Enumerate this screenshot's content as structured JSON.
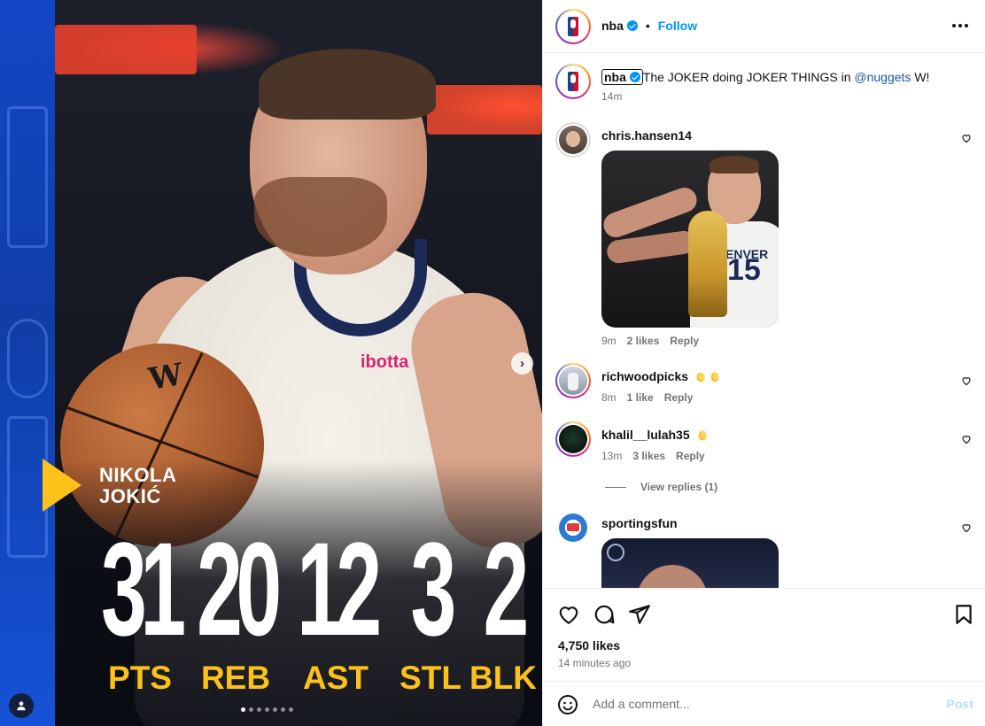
{
  "post": {
    "player": {
      "name_line1": "NIKOLA",
      "name_line2": "JOKIĆ"
    },
    "stats": [
      {
        "value": "31",
        "label": "PTS"
      },
      {
        "value": "20",
        "label": "REB"
      },
      {
        "value": "12",
        "label": "AST"
      },
      {
        "value": "3",
        "label": "STL"
      },
      {
        "value": "2",
        "label": "BLK"
      }
    ],
    "jersey_brand": "ibotta",
    "ball_brand": "W",
    "carousel": {
      "total": 7,
      "active": 0
    },
    "colors": {
      "accent_yellow": "#fcc21a",
      "side_blue": "#1346c6"
    }
  },
  "header": {
    "username": "nba",
    "follow_label": "Follow",
    "separator": "•"
  },
  "caption": {
    "username": "nba",
    "text_before": "The JOKER doing JOKER THINGS in ",
    "mention": "@nuggets",
    "text_after": " W!",
    "time": "14m"
  },
  "comments": [
    {
      "username": "chris.hansen14",
      "time": "9m",
      "likes": "2 likes",
      "reply": "Reply",
      "gif": {
        "jersey_text": "ENVER",
        "jersey_number": "15"
      }
    },
    {
      "username": "richwoodpicks",
      "time": "8m",
      "likes": "1 like",
      "reply": "Reply"
    },
    {
      "username": "khalil__lulah35",
      "time": "13m",
      "likes": "3 likes",
      "reply": "Reply",
      "view_replies": "View replies (1)"
    },
    {
      "username": "sportingsfun"
    }
  ],
  "footer": {
    "likes": "4,750 likes",
    "time": "14 minutes ago",
    "comment_placeholder": "Add a comment...",
    "post_label": "Post"
  }
}
